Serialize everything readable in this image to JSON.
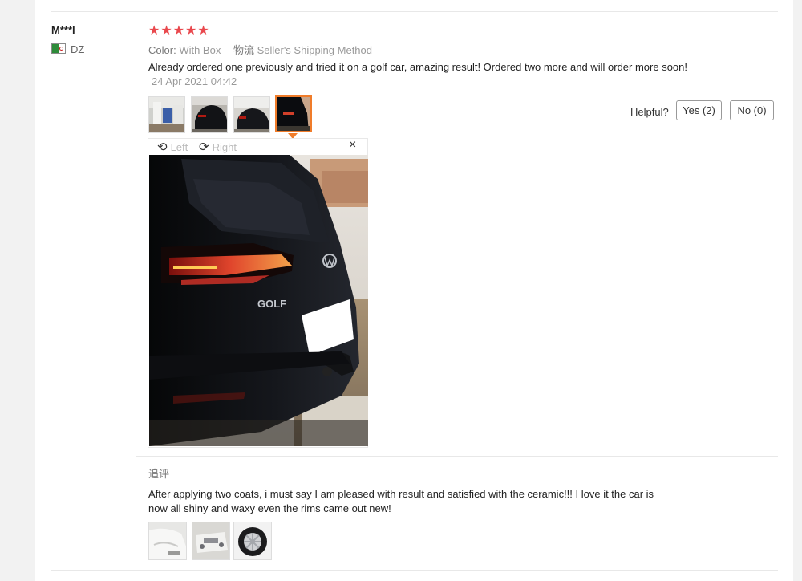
{
  "reviewer": {
    "name": "M***l",
    "country": "DZ"
  },
  "review": {
    "stars": "★★★★★",
    "color_label": "Color:",
    "color_value": "With Box",
    "shipping_label": "物流",
    "shipping_value": "Seller's Shipping Method",
    "text": "Already ordered one previously and tried it on a golf car, amazing result! Ordered two more and will order more soon!",
    "date": "24 Apr 2021 04:42"
  },
  "helpful": {
    "label": "Helpful?",
    "yes": "Yes (2)",
    "no": "No (0)"
  },
  "viewer": {
    "rotate_left": "Left",
    "rotate_right": "Right",
    "close": "×",
    "car_badge": "GOLF"
  },
  "followup": {
    "label": "追评",
    "text_line1": "After applying two coats, i must say I am pleased with result and satisfied with the ceramic!!! I love it the car is",
    "text_line2": "now all shiny and waxy even the rims came out new!"
  },
  "icons": {
    "rotate_left": "rotate-left-icon",
    "rotate_right": "rotate-right-icon",
    "close": "close-icon",
    "flag": "algeria-flag-icon"
  },
  "colors": {
    "star": "#e9484d",
    "active_thumb": "#f07c2a"
  }
}
